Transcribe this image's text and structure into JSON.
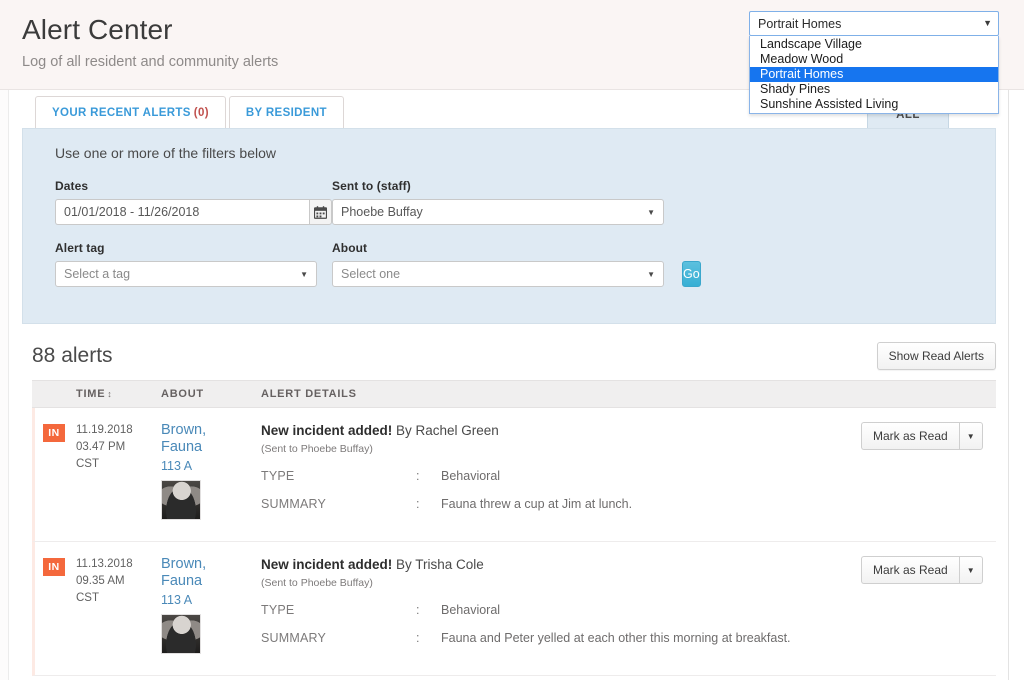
{
  "header": {
    "title": "Alert Center",
    "subtitle": "Log of all resident and community alerts"
  },
  "community_select": {
    "name": "community-selector",
    "selected": "Portrait Homes",
    "caret": "▼",
    "options": [
      "Landscape Village",
      "Meadow Wood",
      "Portrait Homes",
      "Shady Pines",
      "Sunshine Assisted Living"
    ],
    "highlight_color": "#1675ef"
  },
  "tabs": [
    {
      "label": "YOUR RECENT ALERTS",
      "count": "(0)"
    },
    {
      "label": "BY RESIDENT",
      "count": ""
    }
  ],
  "tab_all": "ALL",
  "filters": {
    "hint": "Use one or more of the filters below",
    "dates": {
      "label": "Dates",
      "value": "01/01/2018 - 11/26/2018",
      "icon": "calendar-icon"
    },
    "sent_to": {
      "label": "Sent to (staff)",
      "value": "Phoebe Buffay"
    },
    "alert_tag": {
      "label": "Alert tag",
      "placeholder": "Select a tag"
    },
    "about": {
      "label": "About",
      "placeholder": "Select one"
    },
    "go_label": "Go",
    "go_color": "#37afd4"
  },
  "list": {
    "count_label": "88 alerts",
    "show_read_label": "Show Read Alerts",
    "columns": {
      "badge": "",
      "time": "TIME",
      "about": "ABOUT",
      "details": "ALERT DETAILS",
      "sort_icon": "↕"
    },
    "action_label": "Mark as Read",
    "action_caret": "▼",
    "rows": [
      {
        "badge": "IN",
        "badge_color": "#f4683c",
        "date": "11.19.2018",
        "time": "03.47 PM",
        "tz": "CST",
        "resident_line1": "Brown,",
        "resident_line2": "Fauna",
        "room": "113 A",
        "title_bold": "New incident added!",
        "title_rest": " By Rachel Green",
        "sent_to": "(Sent to Phoebe Buffay)",
        "fields": [
          {
            "key": "TYPE",
            "sep": ":",
            "value": "Behavioral"
          },
          {
            "key": "SUMMARY",
            "sep": ":",
            "value": "Fauna threw a cup at Jim at lunch."
          }
        ]
      },
      {
        "badge": "IN",
        "badge_color": "#f4683c",
        "date": "11.13.2018",
        "time": "09.35 AM",
        "tz": "CST",
        "resident_line1": "Brown,",
        "resident_line2": "Fauna",
        "room": "113 A",
        "title_bold": "New incident added!",
        "title_rest": " By Trisha Cole",
        "sent_to": "(Sent to Phoebe Buffay)",
        "fields": [
          {
            "key": "TYPE",
            "sep": ":",
            "value": "Behavioral"
          },
          {
            "key": "SUMMARY",
            "sep": ":",
            "value": "Fauna and Peter yelled at each other this morning at breakfast."
          }
        ]
      }
    ]
  }
}
